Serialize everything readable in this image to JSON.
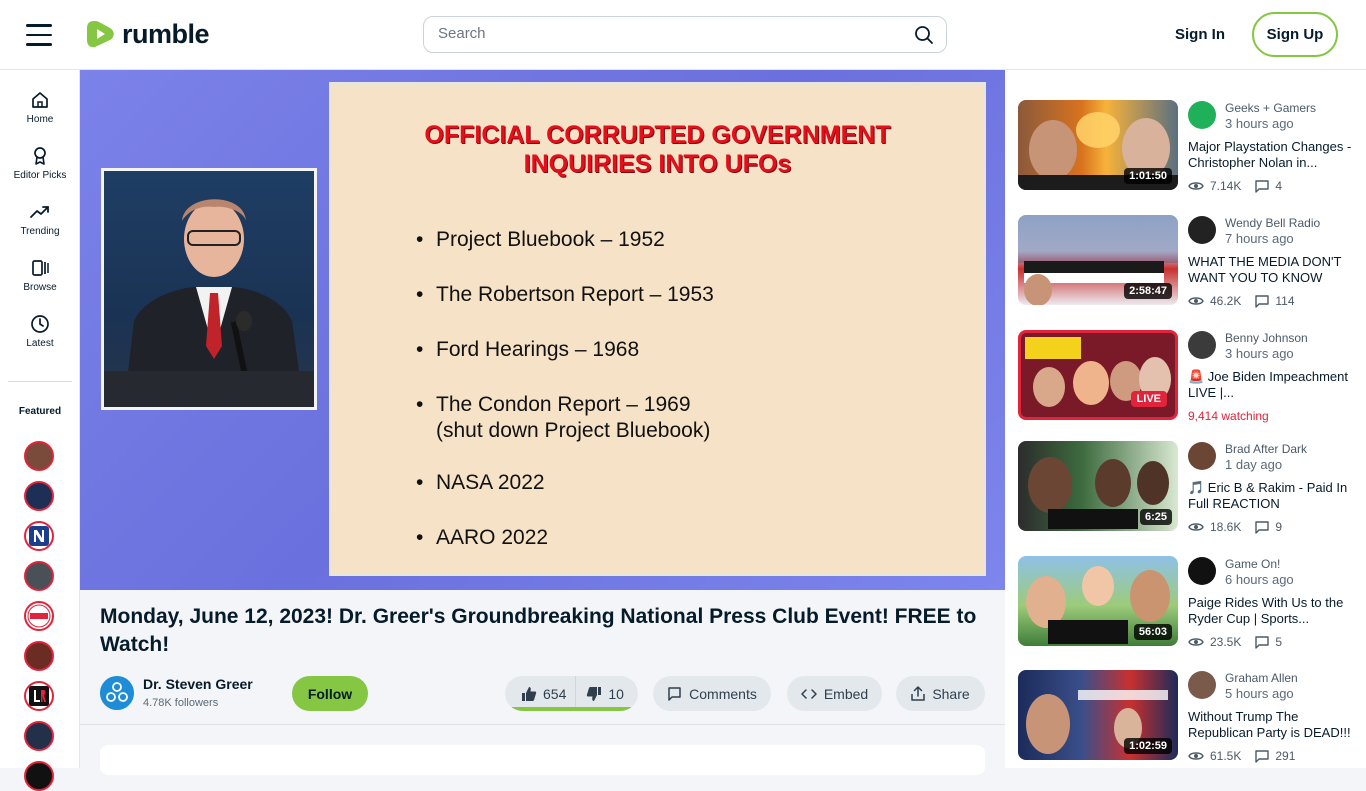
{
  "header": {
    "logo_text": "rumble",
    "search_placeholder": "Search",
    "signin_label": "Sign In",
    "signup_label": "Sign Up",
    "accent_color": "#85c742"
  },
  "leftnav": {
    "items": [
      {
        "label": "Home",
        "icon": "home-icon"
      },
      {
        "label": "Editor Picks",
        "icon": "ribbon-icon"
      },
      {
        "label": "Trending",
        "icon": "trending-icon"
      },
      {
        "label": "Browse",
        "icon": "browse-icon"
      },
      {
        "label": "Latest",
        "icon": "clock-icon"
      }
    ],
    "featured_label": "Featured"
  },
  "video": {
    "slide_title_line1": "OFFICIAL CORRUPTED GOVERNMENT",
    "slide_title_line2": "INQUIRIES INTO UFOs",
    "slide_items": [
      "Project Bluebook – 1952",
      "The Robertson Report – 1953",
      "Ford Hearings – 1968",
      "The Condon Report – 1969",
      "NASA 2022",
      "AARO 2022"
    ],
    "slide_subitem": "(shut down Project Bluebook)",
    "title": "Monday, June 12, 2023! Dr. Greer's Groundbreaking National Press Club Event! FREE to Watch!",
    "channel_name": "Dr. Steven Greer",
    "channel_followers": "4.78K followers",
    "follow_label": "Follow",
    "likes": "654",
    "dislikes": "10",
    "like_ratio": 0.985,
    "comments_label": "Comments",
    "embed_label": "Embed",
    "share_label": "Share"
  },
  "recommendations": [
    {
      "channel": "Geeks + Gamers",
      "time": "3 hours ago",
      "title": "Major Playstation Changes - Christopher Nolan in...",
      "duration": "1:01:50",
      "views": "7.14K",
      "comments": "4"
    },
    {
      "channel": "Wendy Bell Radio",
      "time": "7 hours ago",
      "title": "WHAT THE MEDIA DON'T WANT YOU TO KNOW",
      "duration": "2:58:47",
      "views": "46.2K",
      "comments": "114"
    },
    {
      "channel": "Benny Johnson",
      "time": "3 hours ago",
      "title": "🚨 Joe Biden Impeachment LIVE |...",
      "live": "LIVE",
      "watching": "9,414 watching"
    },
    {
      "channel": "Brad After Dark",
      "time": "1 day ago",
      "title": "🎵 Eric B & Rakim - Paid In Full REACTION",
      "duration": "6:25",
      "views": "18.6K",
      "comments": "9"
    },
    {
      "channel": "Game On!",
      "time": "6 hours ago",
      "title": "Paige Rides With Us to the Ryder Cup | Sports...",
      "duration": "56:03",
      "views": "23.5K",
      "comments": "5"
    },
    {
      "channel": "Graham Allen",
      "time": "5 hours ago",
      "title": "Without Trump The Republican Party is DEAD!!!",
      "duration": "1:02:59",
      "views": "61.5K",
      "comments": "291"
    }
  ]
}
